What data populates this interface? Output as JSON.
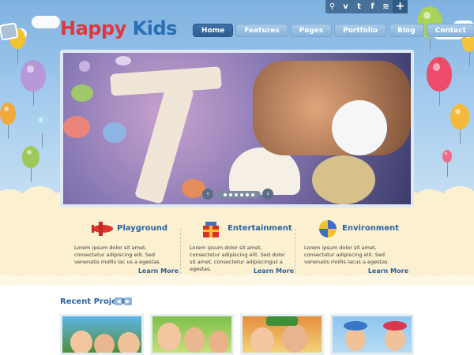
{
  "brand": {
    "word1": "Happy",
    "word2": "Kids"
  },
  "social": {
    "icons": [
      "search-icon",
      "vimeo-icon",
      "twitter-icon",
      "facebook-icon",
      "rss-icon",
      "plus-icon"
    ],
    "glyphs": [
      "⚲",
      "v",
      "t",
      "f",
      "≋",
      "+"
    ]
  },
  "nav": {
    "items": [
      "Home",
      "Features",
      "Pages",
      "Portfolio",
      "Blog",
      "Contact"
    ],
    "active": "Home"
  },
  "slider": {
    "prev": "‹",
    "next": "›"
  },
  "features": [
    {
      "title": "Playground",
      "text": "Lorem ipsum dolor sit amet, consectetur adipiscing elit. Sed venenatis mollis lac us a egestas.",
      "more": "Learn More"
    },
    {
      "title": "Entertainment",
      "text": "Lorem ipsum dolor sit amet, consectetur adipiscing elit. Sed dolor sit amet, consectetur adipiscinguz a egestas.",
      "more": "Learn More"
    },
    {
      "title": "Environment",
      "text": "Lorem ipsum dolor sit amet, consectetur adipiscing elit. Sed venenatis mollis lacus a egestas.",
      "more": "Learn More"
    }
  ],
  "recent": {
    "title": "Recent Projects",
    "prev": "◀",
    "next": "▶"
  },
  "colors": {
    "accent": "#2a62a3",
    "brand_red": "#e0363f",
    "nav_active": "#2e5d91"
  }
}
